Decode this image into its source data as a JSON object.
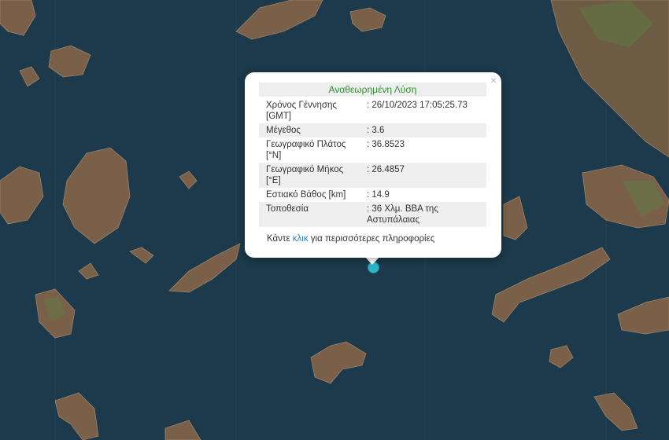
{
  "map": {
    "sea_color": "#1d3a4a",
    "land_color": "#7a6048",
    "marker_color": "#2ab4c6"
  },
  "popup": {
    "title": "Αναθεωρημένη Λύση",
    "title_color": "#2f8f2f",
    "close_icon": "×",
    "rows": [
      {
        "label": "Χρόνος Γέννησης [GMT]",
        "value": ": 26/10/2023 17:05:25.73"
      },
      {
        "label": "Μέγεθος",
        "value": ": 3.6"
      },
      {
        "label": "Γεωγραφικό Πλάτος [°N]",
        "value": ": 36.8523"
      },
      {
        "label": "Γεωγραφικό Μήκος [°E]",
        "value": ": 26.4857"
      },
      {
        "label": "Εστιακό Βάθος [km]",
        "value": ": 14.9"
      },
      {
        "label": "Τοποθεσία",
        "value": ": 36 Χλμ. ΒΒΑ της Αστυπάλαιας"
      }
    ],
    "more_prefix": "Κάντε ",
    "more_link": "κλικ",
    "more_suffix": " για περισσότερες πληροφορίες",
    "link_color": "#2a7fc0"
  }
}
